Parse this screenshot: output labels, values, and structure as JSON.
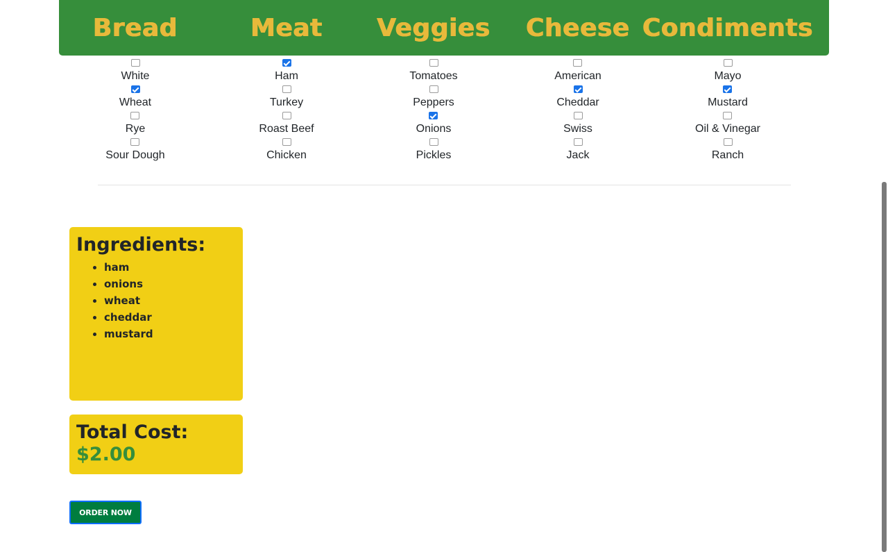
{
  "categories": [
    {
      "title": "Bread",
      "options": [
        {
          "label": "White",
          "checked": false
        },
        {
          "label": "Wheat",
          "checked": true
        },
        {
          "label": "Rye",
          "checked": false
        },
        {
          "label": "Sour Dough",
          "checked": false
        }
      ]
    },
    {
      "title": "Meat",
      "options": [
        {
          "label": "Ham",
          "checked": true
        },
        {
          "label": "Turkey",
          "checked": false
        },
        {
          "label": "Roast Beef",
          "checked": false
        },
        {
          "label": "Chicken",
          "checked": false
        }
      ]
    },
    {
      "title": "Veggies",
      "options": [
        {
          "label": "Tomatoes",
          "checked": false
        },
        {
          "label": "Peppers",
          "checked": false
        },
        {
          "label": "Onions",
          "checked": true
        },
        {
          "label": "Pickles",
          "checked": false
        }
      ]
    },
    {
      "title": "Cheese",
      "options": [
        {
          "label": "American",
          "checked": false
        },
        {
          "label": "Cheddar",
          "checked": true
        },
        {
          "label": "Swiss",
          "checked": false
        },
        {
          "label": "Jack",
          "checked": false
        }
      ]
    },
    {
      "title": "Condiments",
      "options": [
        {
          "label": "Mayo",
          "checked": false
        },
        {
          "label": "Mustard",
          "checked": true
        },
        {
          "label": "Oil & Vinegar",
          "checked": false
        },
        {
          "label": "Ranch",
          "checked": false
        }
      ]
    }
  ],
  "ingredients": {
    "heading": "Ingredients:",
    "items": [
      "ham",
      "onions",
      "wheat",
      "cheddar",
      "mustard"
    ]
  },
  "total": {
    "heading": "Total Cost:",
    "price": "$2.00"
  },
  "order_button": "ORDER NOW",
  "colors": {
    "header_bg": "#368e3b",
    "header_text": "#e8b93b",
    "card_bg": "#f1cf15",
    "price_text": "#368e3b",
    "button_bg": "#007d3f",
    "checkbox_checked": "#1a73e8"
  }
}
